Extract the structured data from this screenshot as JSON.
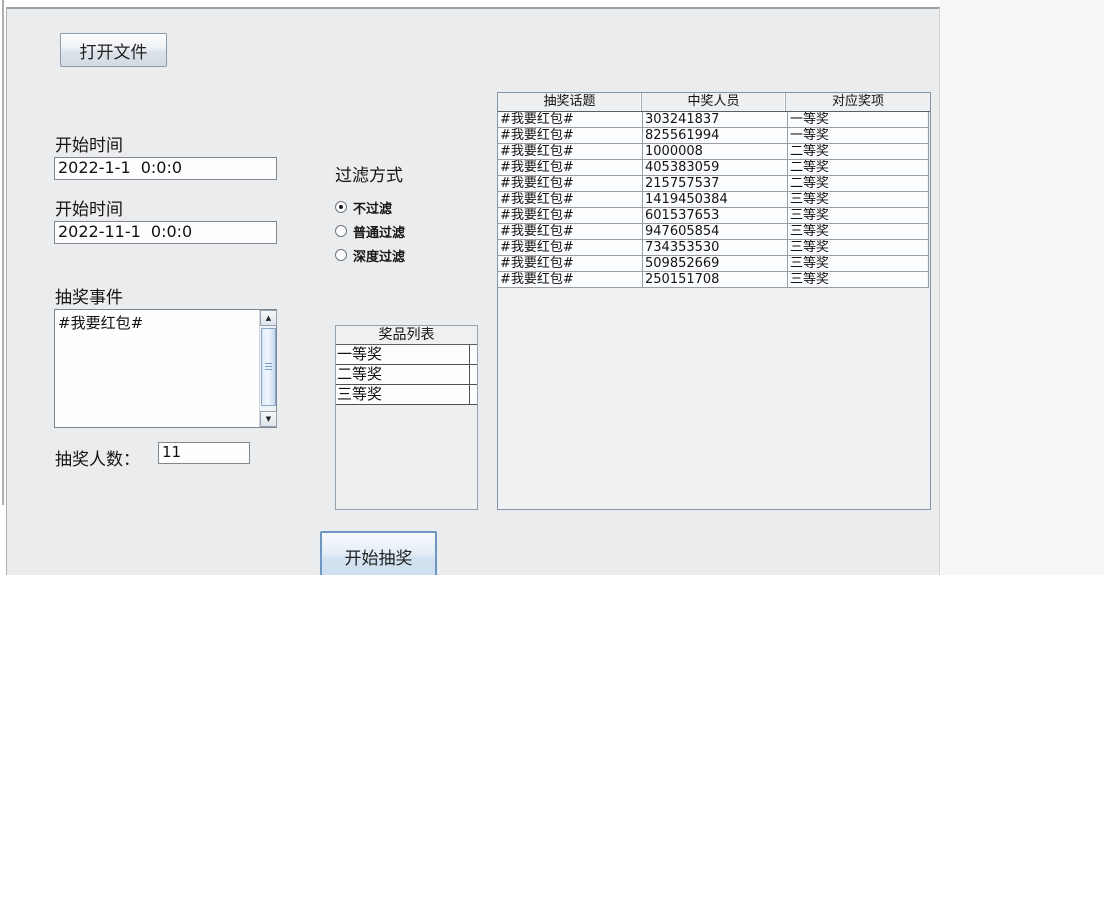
{
  "window": {
    "open_file_button": "打开文件",
    "start_draw_button": "开始抽奖"
  },
  "left_panel": {
    "start_time_label_1": "开始时间",
    "start_time_value_1": "2022-1-1 0:0:0",
    "start_time_label_2": "开始时间",
    "start_time_value_2": "2022-11-1 0:0:0",
    "event_label": "抽奖事件",
    "event_text": "#我要红包#",
    "count_label": "抽奖人数：",
    "count_value": "11"
  },
  "filter": {
    "title": "过滤方式",
    "options": [
      {
        "label": "不过滤",
        "selected": true
      },
      {
        "label": "普通过滤",
        "selected": false
      },
      {
        "label": "深度过滤",
        "selected": false
      }
    ]
  },
  "prize_list": {
    "header": "奖品列表",
    "items": [
      "一等奖",
      "二等奖",
      "三等奖"
    ]
  },
  "results_table": {
    "columns": [
      "抽奖话题",
      "中奖人员",
      "对应奖项"
    ],
    "rows": [
      [
        "#我要红包#",
        "303241837",
        "一等奖"
      ],
      [
        "#我要红包#",
        "825561994",
        "一等奖"
      ],
      [
        "#我要红包#",
        "1000008",
        "二等奖"
      ],
      [
        "#我要红包#",
        "405383059",
        "二等奖"
      ],
      [
        "#我要红包#",
        "215757537",
        "二等奖"
      ],
      [
        "#我要红包#",
        "1419450384",
        "三等奖"
      ],
      [
        "#我要红包#",
        "601537653",
        "三等奖"
      ],
      [
        "#我要红包#",
        "947605854",
        "三等奖"
      ],
      [
        "#我要红包#",
        "734353530",
        "三等奖"
      ],
      [
        "#我要红包#",
        "509852669",
        "三等奖"
      ],
      [
        "#我要红包#",
        "250151708",
        "三等奖"
      ]
    ]
  },
  "icons": {
    "scroll_up": "▲",
    "scroll_down": "▼"
  },
  "colors": {
    "window_bg": "#ebecee",
    "pane_border": "#8196aa",
    "accent_blue": "#6f96c2",
    "cell_bg": "#fcfdfe"
  }
}
